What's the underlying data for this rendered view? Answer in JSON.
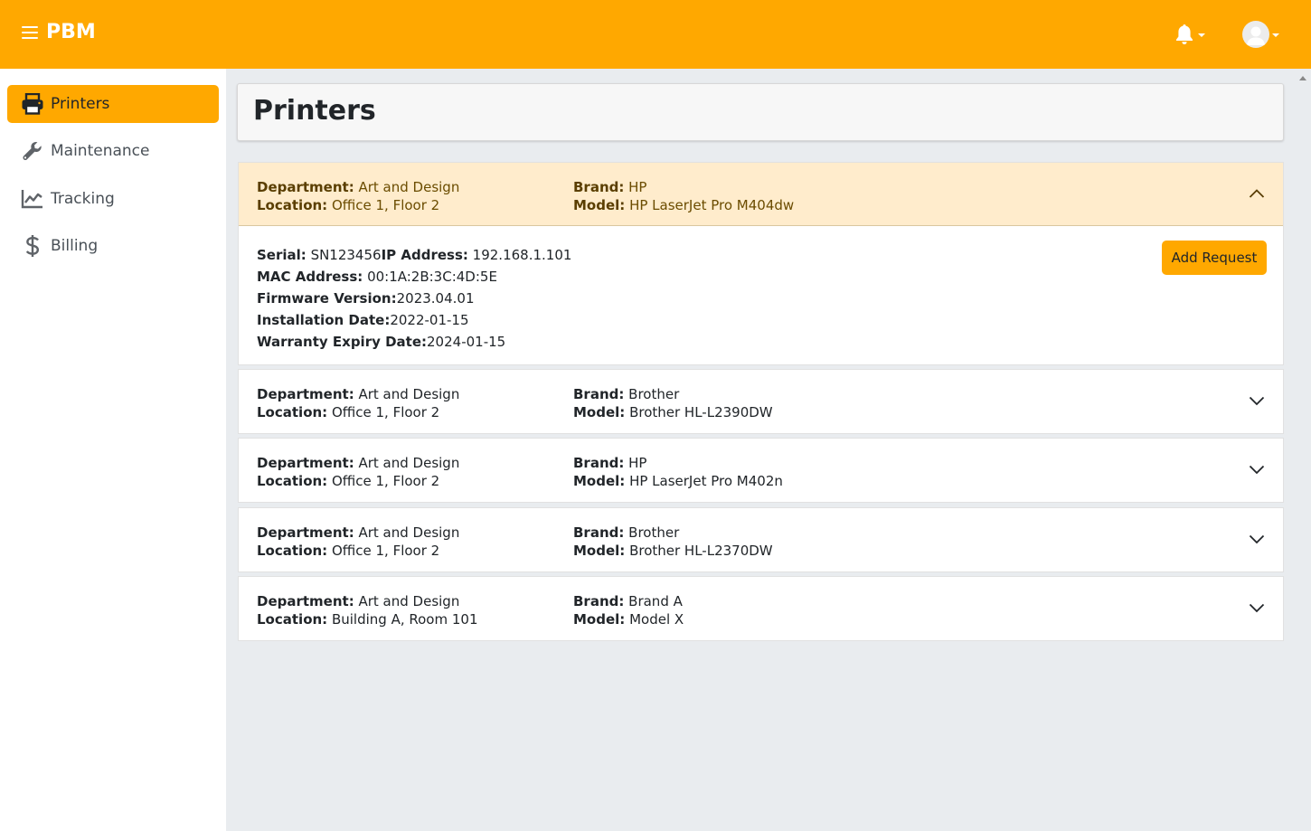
{
  "app": {
    "logo": "PBM"
  },
  "sidebar": {
    "items": [
      {
        "label": "Printers",
        "icon": "printer-icon",
        "active": true
      },
      {
        "label": "Maintenance",
        "icon": "wrench-icon",
        "active": false
      },
      {
        "label": "Tracking",
        "icon": "chart-line-icon",
        "active": false
      },
      {
        "label": "Billing",
        "icon": "dollar-icon",
        "active": false
      }
    ]
  },
  "page": {
    "title": "Printers"
  },
  "labels": {
    "department": "Department:",
    "location": "Location:",
    "brand": "Brand:",
    "model": "Model:",
    "serial": "Serial:",
    "ip": "IP Address:",
    "mac": "MAC Address:",
    "firmware": "Firmware Version:",
    "install": "Installation Date:",
    "warranty": "Warranty Expiry Date:"
  },
  "printers": [
    {
      "department": "Art and Design",
      "location": "Office 1, Floor 2",
      "brand": "HP",
      "model": "HP LaserJet Pro M404dw",
      "expanded": true,
      "serial": "SN123456",
      "ip": "192.168.1.101",
      "mac": "00:1A:2B:3C:4D:5E",
      "firmware": "2023.04.01",
      "install": "2022-01-15",
      "warranty": "2024-01-15",
      "action": "Add Request"
    },
    {
      "department": "Art and Design",
      "location": "Office 1, Floor 2",
      "brand": "Brother",
      "model": "Brother HL-L2390DW",
      "expanded": false
    },
    {
      "department": "Art and Design",
      "location": "Office 1, Floor 2",
      "brand": "HP",
      "model": "HP LaserJet Pro M402n",
      "expanded": false
    },
    {
      "department": "Art and Design",
      "location": "Office 1, Floor 2",
      "brand": "Brother",
      "model": "Brother HL-L2370DW",
      "expanded": false
    },
    {
      "department": "Art and Design",
      "location": "Building A, Room 101",
      "brand": "Brand A",
      "model": "Model X",
      "expanded": false
    }
  ],
  "colors": {
    "accent": "#ffa800",
    "open_header": "#ffeccc"
  }
}
